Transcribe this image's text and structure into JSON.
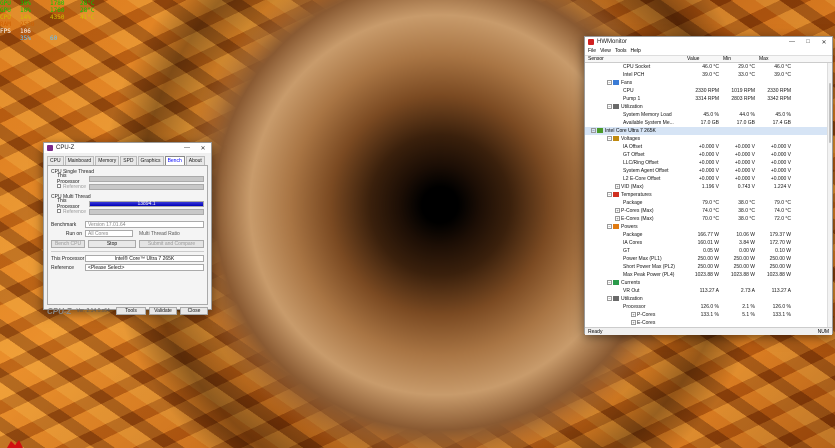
{
  "osd": {
    "lines": [
      {
        "label": "GPU",
        "val1": "30%",
        "val2": "1780",
        "val3": "28°C",
        "color": "#00d000"
      },
      {
        "label": "GPU",
        "val1": "10%",
        "val2": "1760",
        "val3": "28°C",
        "color": "#00d000"
      },
      {
        "label": "CPU",
        "val1": "14%",
        "val2": "4350",
        "val3": "41°C",
        "color": "#d0c000"
      },
      {
        "label": "RAM",
        "val1": "2530",
        "val2": "",
        "val3": "",
        "color": "#d06000"
      },
      {
        "label": "FPS",
        "val1": "106",
        "val2": "",
        "val3": "",
        "color": "#ffffff"
      },
      {
        "label": "",
        "val1": "35%",
        "val2": "60",
        "val3": "",
        "color": "#60c0ff"
      }
    ]
  },
  "cpuz": {
    "title": "CPU-Z",
    "tabs": [
      "CPU",
      "Mainboard",
      "Memory",
      "SPD",
      "Graphics",
      "Bench",
      "About"
    ],
    "single_thread": {
      "group": "CPU Single Thread",
      "this_processor": "This Processor",
      "reference": "Reference"
    },
    "multi_thread": {
      "group": "CPU Multi Thread",
      "this_processor": "This Processor",
      "value": "13894.1",
      "fill_fraction": 1.0,
      "reference": "Reference"
    },
    "benchmark_label": "Benchmark",
    "benchmark_value": "Version 17.01.64",
    "runon_label": "Run on",
    "runon_value": "All Cores",
    "ratio_label": "Multi Thread Ratio",
    "bench_cpu": "Bench CPU",
    "stop": "Stop",
    "submit": "Submit and Compare",
    "this_proc_label": "This Processor",
    "this_proc_value": "Intel® Core™ Ultra 7 265K",
    "reference_label": "Reference",
    "reference_value": "<Please Select>",
    "footer": {
      "logo": "CPU-Z",
      "version": "Ver. 2.14.0.x64",
      "tools": "Tools",
      "validate": "Validate",
      "close": "Close"
    }
  },
  "hwm": {
    "title": "HWMonitor",
    "menu": [
      "File",
      "View",
      "Tools",
      "Help"
    ],
    "columns": {
      "sensor": "Sensor",
      "value": "Value",
      "min": "Min",
      "max": "Max"
    },
    "status_left": "Ready",
    "status_right": "NUM",
    "rows": [
      {
        "indent": 4,
        "type": "item",
        "name": "CPU Socket",
        "v": "46.0 °C",
        "mn": "29.0 °C",
        "mx": "46.0 °C"
      },
      {
        "indent": 4,
        "type": "item",
        "name": "Intel PCH",
        "v": "39.0 °C",
        "mn": "33.0 °C",
        "mx": "39.0 °C"
      },
      {
        "indent": 2,
        "type": "cat",
        "name": "Fans",
        "icon": "fan-icon",
        "v": "",
        "mn": "",
        "mx": ""
      },
      {
        "indent": 4,
        "type": "item",
        "name": "CPU",
        "v": "2330 RPM",
        "mn": "1019 RPM",
        "mx": "2330 RPM"
      },
      {
        "indent": 4,
        "type": "item",
        "name": "Pump 1",
        "v": "3314 RPM",
        "mn": "2803 RPM",
        "mx": "3342 RPM"
      },
      {
        "indent": 2,
        "type": "cat",
        "name": "Utilization",
        "icon": "utilization-icon",
        "v": "",
        "mn": "",
        "mx": ""
      },
      {
        "indent": 4,
        "type": "item",
        "name": "System Memory Load",
        "v": "45.0 %",
        "mn": "44.0 %",
        "mx": "45.0 %"
      },
      {
        "indent": 4,
        "type": "item",
        "name": "Available System Me...",
        "v": "17.0 GB",
        "mn": "17.0 GB",
        "mx": "17.4 GB"
      },
      {
        "indent": 0,
        "type": "dev",
        "name": "Intel Core Ultra 7 265K",
        "icon": "cpu-chip-icon",
        "v": "",
        "mn": "",
        "mx": ""
      },
      {
        "indent": 2,
        "type": "cat",
        "name": "Voltages",
        "icon": "voltage-icon",
        "v": "",
        "mn": "",
        "mx": ""
      },
      {
        "indent": 4,
        "type": "item",
        "name": "IA Offset",
        "v": "+0.000 V",
        "mn": "+0.000 V",
        "mx": "+0.000 V"
      },
      {
        "indent": 4,
        "type": "item",
        "name": "GT Offset",
        "v": "+0.000 V",
        "mn": "+0.000 V",
        "mx": "+0.000 V"
      },
      {
        "indent": 4,
        "type": "item",
        "name": "LLC/Ring Offset",
        "v": "+0.000 V",
        "mn": "+0.000 V",
        "mx": "+0.000 V"
      },
      {
        "indent": 4,
        "type": "item",
        "name": "System Agent Offset",
        "v": "+0.000 V",
        "mn": "+0.000 V",
        "mx": "+0.000 V"
      },
      {
        "indent": 4,
        "type": "item",
        "name": "L2 E-Core Offset",
        "v": "+0.000 V",
        "mn": "+0.000 V",
        "mx": "+0.000 V"
      },
      {
        "indent": 3,
        "type": "sub",
        "name": "VID (Max)",
        "v": "1.196 V",
        "mn": "0.743 V",
        "mx": "1.224 V"
      },
      {
        "indent": 2,
        "type": "cat",
        "name": "Temperatures",
        "icon": "thermometer-icon",
        "v": "",
        "mn": "",
        "mx": ""
      },
      {
        "indent": 4,
        "type": "item",
        "name": "Package",
        "v": "79.0 °C",
        "mn": "38.0 °C",
        "mx": "79.0 °C"
      },
      {
        "indent": 3,
        "type": "sub",
        "name": "P-Cores (Max)",
        "v": "74.0 °C",
        "mn": "38.0 °C",
        "mx": "74.0 °C"
      },
      {
        "indent": 3,
        "type": "sub",
        "name": "E-Cores (Max)",
        "v": "70.0 °C",
        "mn": "38.0 °C",
        "mx": "72.0 °C"
      },
      {
        "indent": 2,
        "type": "cat",
        "name": "Powers",
        "icon": "power-icon",
        "v": "",
        "mn": "",
        "mx": ""
      },
      {
        "indent": 4,
        "type": "item",
        "name": "Package",
        "v": "166.77 W",
        "mn": "10.06 W",
        "mx": "179.37 W"
      },
      {
        "indent": 4,
        "type": "item",
        "name": "IA Cores",
        "v": "160.01 W",
        "mn": "3.84 W",
        "mx": "172.70 W"
      },
      {
        "indent": 4,
        "type": "item",
        "name": "GT",
        "v": "0.05 W",
        "mn": "0.00 W",
        "mx": "0.10 W"
      },
      {
        "indent": 4,
        "type": "item",
        "name": "Power Max (PL1)",
        "v": "250.00 W",
        "mn": "250.00 W",
        "mx": "250.00 W"
      },
      {
        "indent": 4,
        "type": "item",
        "name": "Short Power Max (PL2)",
        "v": "250.00 W",
        "mn": "250.00 W",
        "mx": "250.00 W"
      },
      {
        "indent": 4,
        "type": "item",
        "name": "Max Peak Power (PL4)",
        "v": "1023.88 W",
        "mn": "1023.88 W",
        "mx": "1023.88 W"
      },
      {
        "indent": 2,
        "type": "cat",
        "name": "Currents",
        "icon": "current-icon",
        "v": "",
        "mn": "",
        "mx": ""
      },
      {
        "indent": 4,
        "type": "item",
        "name": "VR Out",
        "v": "113.27 A",
        "mn": "2.73 A",
        "mx": "113.27 A"
      },
      {
        "indent": 2,
        "type": "cat",
        "name": "Utilization",
        "icon": "utilization-icon",
        "v": "",
        "mn": "",
        "mx": ""
      },
      {
        "indent": 4,
        "type": "item",
        "name": "Processor",
        "v": "126.0 %",
        "mn": "2.1 %",
        "mx": "126.0 %"
      },
      {
        "indent": 5,
        "type": "sub",
        "name": "P-Cores",
        "v": "133.1 %",
        "mn": "5.1 %",
        "mx": "133.1 %"
      },
      {
        "indent": 5,
        "type": "sub",
        "name": "E-Cores",
        "v": "",
        "mn": "",
        "mx": ""
      }
    ]
  }
}
